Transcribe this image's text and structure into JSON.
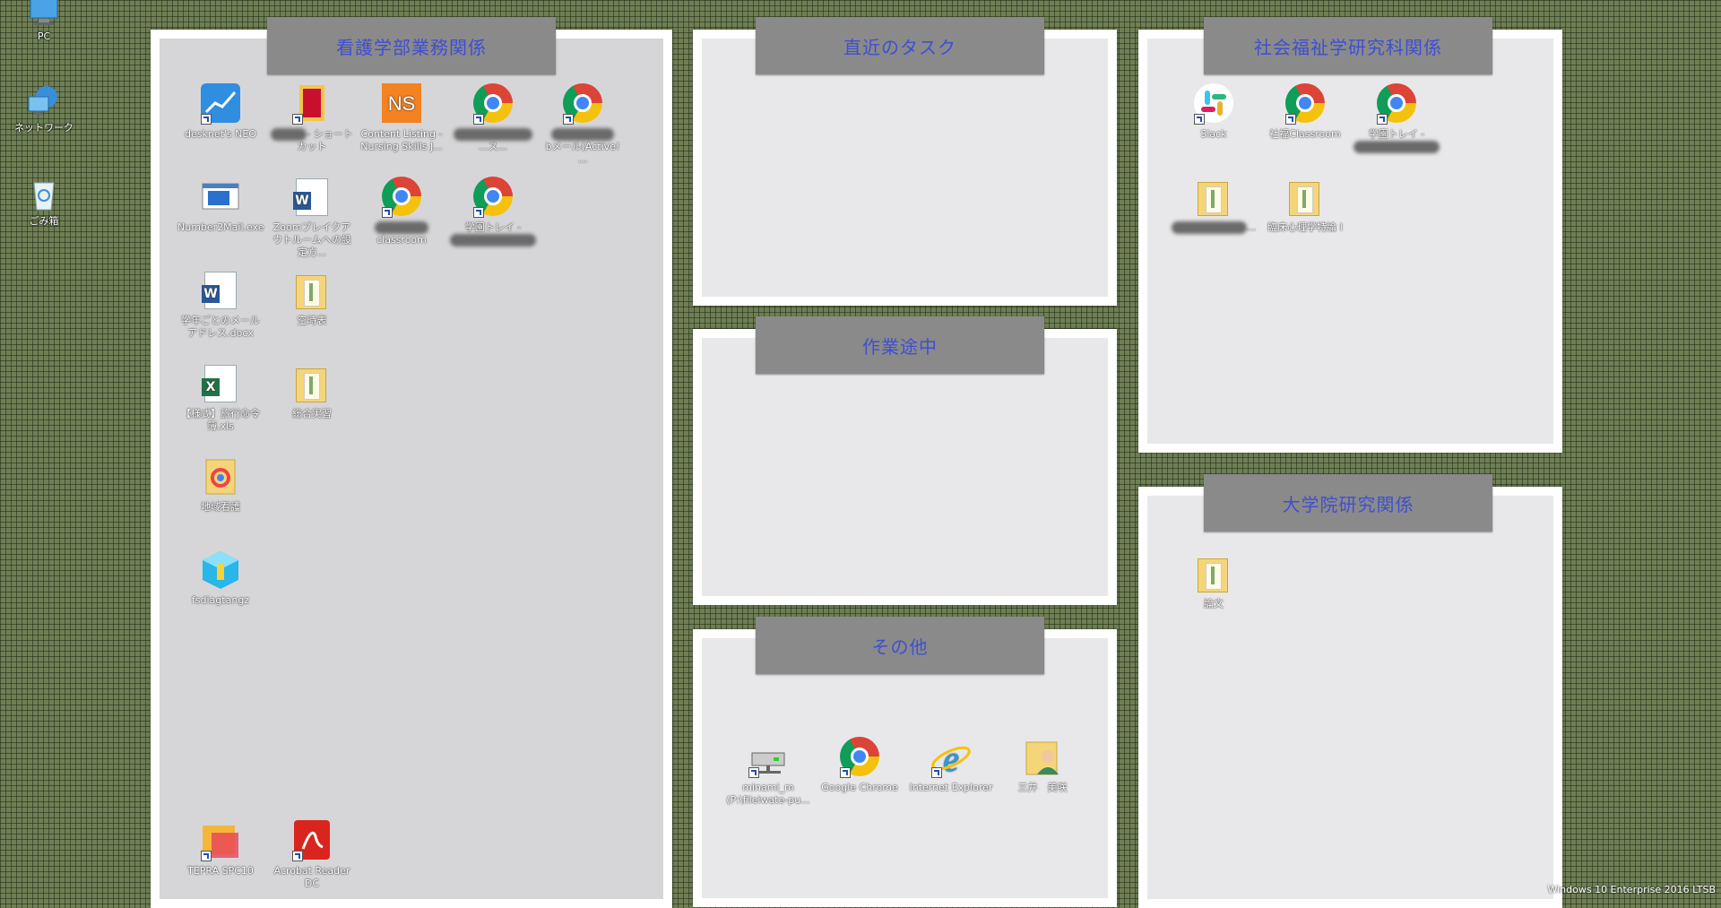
{
  "desktop_left": [
    {
      "label": "PC",
      "icon": "pc-icon"
    },
    {
      "label": "ネットワーク",
      "icon": "network-icon"
    },
    {
      "label": "ごみ箱",
      "icon": "recycle-bin-icon"
    }
  ],
  "panels": {
    "nursing": {
      "title": "看護学部業務関係",
      "items": [
        {
          "label": "desknet's NEO",
          "icon": "desknets-icon"
        },
        {
          "label": "- ショートカット",
          "icon": "shortcut-book-icon"
        },
        {
          "label": "Content Listing - Nursing Skills J...",
          "icon": "nursing-skills-icon"
        },
        {
          "label": "...ス...",
          "icon": "chrome-icon"
        },
        {
          "label": "bメール(Active! ...",
          "icon": "chrome-icon"
        },
        {
          "label": "Number2Mail.exe",
          "icon": "app-window-icon"
        },
        {
          "label": "Zoomブレイクアウトルームへの設定方...",
          "icon": "word-doc-icon"
        },
        {
          "label": "classroom",
          "icon": "chrome-icon"
        },
        {
          "label": "学園トレイ -",
          "icon": "chrome-icon"
        },
        {
          "label": "学年ごとのメールアドレス.docx",
          "icon": "word-doc-icon"
        },
        {
          "label": "空時表",
          "icon": "folder-icon"
        },
        {
          "label": "【様式】旅行命令簿.xls",
          "icon": "excel-icon"
        },
        {
          "label": "総合実習",
          "icon": "folder-icon"
        },
        {
          "label": "地域看護",
          "icon": "colorful-folder-icon"
        },
        {
          "label": "fsdiagtangz",
          "icon": "cube-app-icon"
        },
        {
          "label": "TEPRA SPC10",
          "icon": "tepra-icon"
        },
        {
          "label": "Acrobat Reader DC",
          "icon": "acrobat-icon"
        }
      ]
    },
    "recent": {
      "title": "直近のタスク"
    },
    "inprogress": {
      "title": "作業途中"
    },
    "other": {
      "title": "その他",
      "items": [
        {
          "label": "minami_m (P:\\fileiwate-pu...",
          "icon": "network-drive-icon"
        },
        {
          "label": "Google Chrome",
          "icon": "chrome-icon"
        },
        {
          "label": "Internet Explorer",
          "icon": "ie-icon"
        },
        {
          "label": "三井　美咲",
          "icon": "user-folder-icon"
        }
      ]
    },
    "social": {
      "title": "社会福祉学研究科関係",
      "items": [
        {
          "label": "Slack",
          "icon": "slack-icon"
        },
        {
          "label": "社福Classroom",
          "icon": "chrome-icon"
        },
        {
          "label": "学園トレイ -",
          "icon": "chrome-icon"
        },
        {
          "label": "...",
          "icon": "folder-icon"
        },
        {
          "label": "臨床心理学特論 I",
          "icon": "folder-icon"
        }
      ]
    },
    "grad": {
      "title": "大学院研究関係",
      "items": [
        {
          "label": "論文",
          "icon": "folder-icon"
        }
      ]
    }
  },
  "windows_version": "Windows 10 Enterprise 2016 LTSB"
}
